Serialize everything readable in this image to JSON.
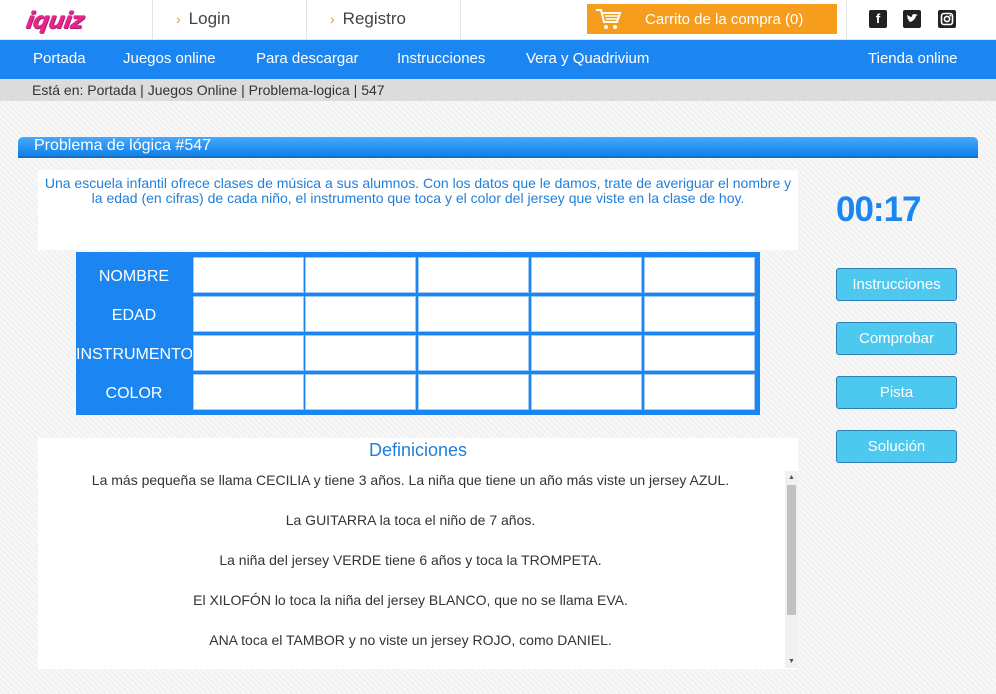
{
  "header": {
    "logo_text": "iquiz",
    "login_label": "Login",
    "register_label": "Registro",
    "cart_label": "Carrito de la compra (0)",
    "social": [
      "facebook-icon",
      "twitter-icon",
      "instagram-icon"
    ]
  },
  "nav": {
    "items": [
      "Portada",
      "Juegos online",
      "Para descargar",
      "Instrucciones",
      "Vera y Quadrivium"
    ],
    "shop_label": "Tienda online"
  },
  "breadcrumb": "Está en: Portada | Juegos Online | Problema-logica | 547",
  "puzzle": {
    "title": "Problema de lógica #547",
    "statement": "Una escuela infantil ofrece clases de música a sus alumnos. Con los datos que le damos, trate de averiguar el nombre y la edad (en cifras) de cada niño, el instrumento que toca y el color del jersey que viste en la clase de hoy.",
    "timer": "00:17",
    "row_labels": [
      "NOMBRE",
      "EDAD",
      "INSTRUMENTO",
      "COLOR"
    ],
    "cell_values": [
      [
        "",
        "",
        "",
        "",
        ""
      ],
      [
        "",
        "",
        "",
        "",
        ""
      ],
      [
        "",
        "",
        "",
        "",
        ""
      ],
      [
        "",
        "",
        "",
        "",
        ""
      ]
    ]
  },
  "buttons": {
    "instructions": "Instrucciones",
    "check": "Comprobar",
    "hint": "Pista",
    "solution": "Solución"
  },
  "definitions": {
    "title": "Definiciones",
    "items": [
      "La más pequeña se llama CECILIA y tiene 3 años. La niña que tiene un año más viste un jersey AZUL.",
      "La GUITARRA la toca el niño de 7 años.",
      "La niña del jersey VERDE tiene 6 años y toca la TROMPETA.",
      "El XILOFÓN lo toca la niña del jersey BLANCO, que no se llama EVA.",
      "ANA toca el TAMBOR y no viste un jersey ROJO, como DANIEL."
    ]
  },
  "colors": {
    "accent": "#1b86f2",
    "cart": "#f79d1e",
    "logo": "#e3268c",
    "button": "#4dc8ee"
  }
}
